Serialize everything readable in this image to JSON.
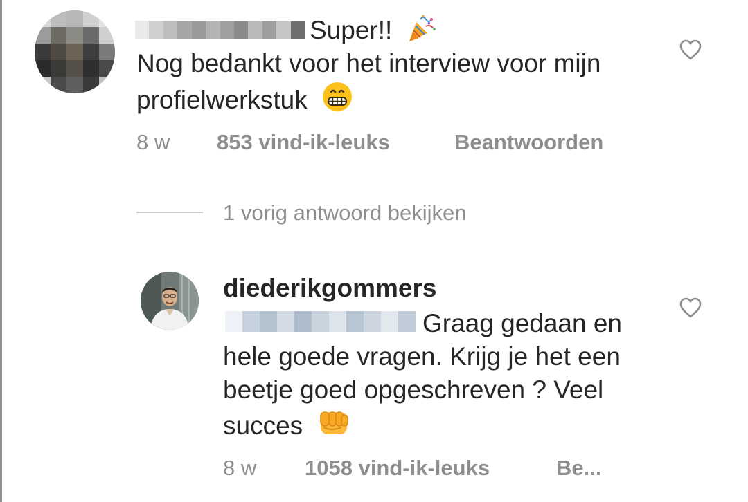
{
  "comment": {
    "text_line1": "Super!!",
    "text_body": "Nog bedankt voor het interview voor mijn profielwerkstuk",
    "time": "8 w",
    "likes": "853 vind-ik-leuks",
    "reply_label": "Beantwoorden"
  },
  "replies_toggle": {
    "label": "1 vorig antwoord bekijken"
  },
  "reply": {
    "username": "diederikgommers",
    "text_line1": "Graag gedaan en",
    "text_body": "hele goede vragen. Krijg je het een beetje goed opgeschreven ? Veel succes",
    "time": "8 w",
    "likes": "1058 vind-ik-leuks",
    "reply_label": "Be..."
  },
  "icons": {
    "like": "heart-outline-icon",
    "party": "party-popper-emoji",
    "grin": "grinning-face-emoji",
    "fist": "oncoming-fist-emoji"
  },
  "colors": {
    "text": "#262626",
    "secondary": "#8e8e8e",
    "divider": "#c7c7c7",
    "background": "#ffffff"
  }
}
